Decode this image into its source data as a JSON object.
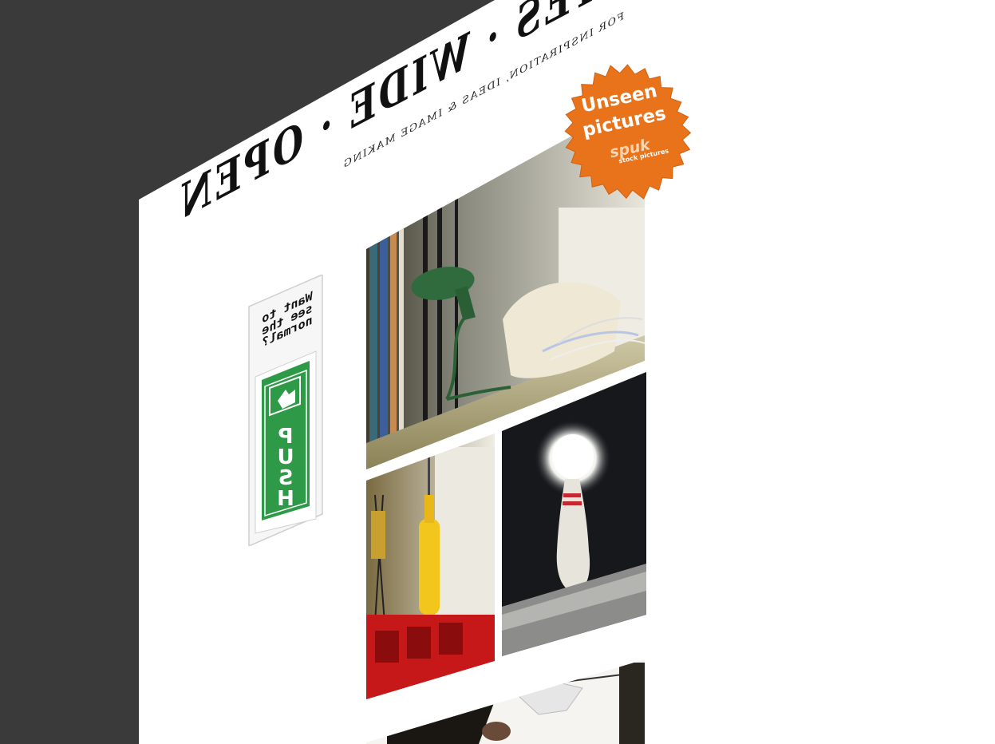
{
  "header": {
    "title": "EYES · WIDE · OPEN",
    "tagline": "FOR INSPIRATION, IDEAS & IMAGE MAKING"
  },
  "badge": {
    "line1": "Unseen",
    "line2": "pictures",
    "logo": "spuk",
    "logo_sub": "stock pictures",
    "color": "#e8731a"
  },
  "sidebar": {
    "question_lines": [
      "Want to",
      "see the",
      "normal?"
    ],
    "sign_label_letters": [
      "P",
      "U",
      "S",
      "H"
    ],
    "sign_icon": "hand-pointer-icon",
    "sign_color": "#2e9a48"
  },
  "gallery": {
    "photos": [
      {
        "name": "telephone-photo",
        "icon": "telephone-icon"
      },
      {
        "name": "yellow-bottle-photo",
        "icon": "bottle-icon"
      },
      {
        "name": "bowling-pin-photo",
        "icon": "bowling-pin-icon"
      },
      {
        "name": "studio-lamp-photo",
        "icon": "lamp-icon"
      }
    ]
  },
  "colors": {
    "background": "#3a3a3a",
    "page": "#ffffff",
    "accent": "#e8731a"
  }
}
